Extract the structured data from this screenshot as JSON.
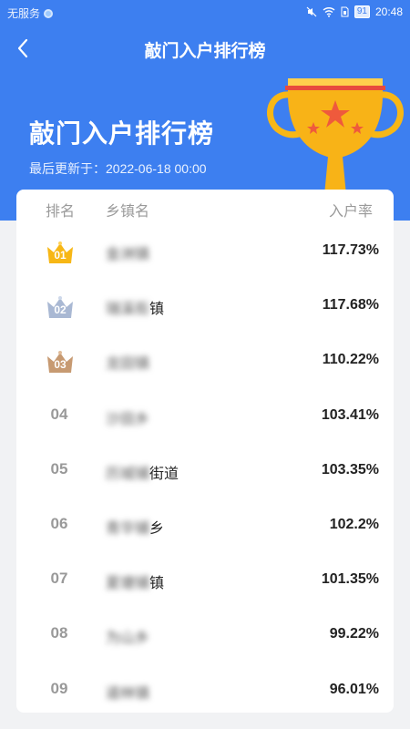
{
  "status_bar": {
    "left_text": "无服务",
    "battery": "91",
    "time": "20:48"
  },
  "nav": {
    "title": "敲门入户排行榜"
  },
  "hero": {
    "title": "敲门入户排行榜",
    "update": "最后更新于：2022-06-18 00:00"
  },
  "table": {
    "headers": {
      "rank": "排名",
      "town": "乡镇名",
      "rate": "入户率"
    },
    "rows": [
      {
        "rank": "01",
        "town_blur": "金洲镇",
        "town_clear": "",
        "rate": "117.73%"
      },
      {
        "rank": "02",
        "town_blur": "瑞溪街",
        "town_clear": "镇",
        "rate": "117.68%"
      },
      {
        "rank": "03",
        "town_blur": "龙田镇",
        "town_clear": "",
        "rate": "110.22%"
      },
      {
        "rank": "04",
        "town_blur": "沙田乡",
        "town_clear": "",
        "rate": "103.41%"
      },
      {
        "rank": "05",
        "town_blur": "历城铺",
        "town_clear": "街道",
        "rate": "103.35%"
      },
      {
        "rank": "06",
        "town_blur": "青华铺",
        "town_clear": "乡",
        "rate": "102.2%"
      },
      {
        "rank": "07",
        "town_blur": "夏塘铺",
        "town_clear": "镇",
        "rate": "101.35%"
      },
      {
        "rank": "08",
        "town_blur": "为山乡",
        "town_clear": "",
        "rate": "99.22%"
      },
      {
        "rank": "09",
        "town_blur": "道林镇",
        "town_clear": "",
        "rate": "96.01%"
      }
    ]
  },
  "colors": {
    "header_blue": "#3d7ff0",
    "gold": "#f7b716",
    "silver": "#a9b8d3",
    "bronze": "#c79a72"
  }
}
